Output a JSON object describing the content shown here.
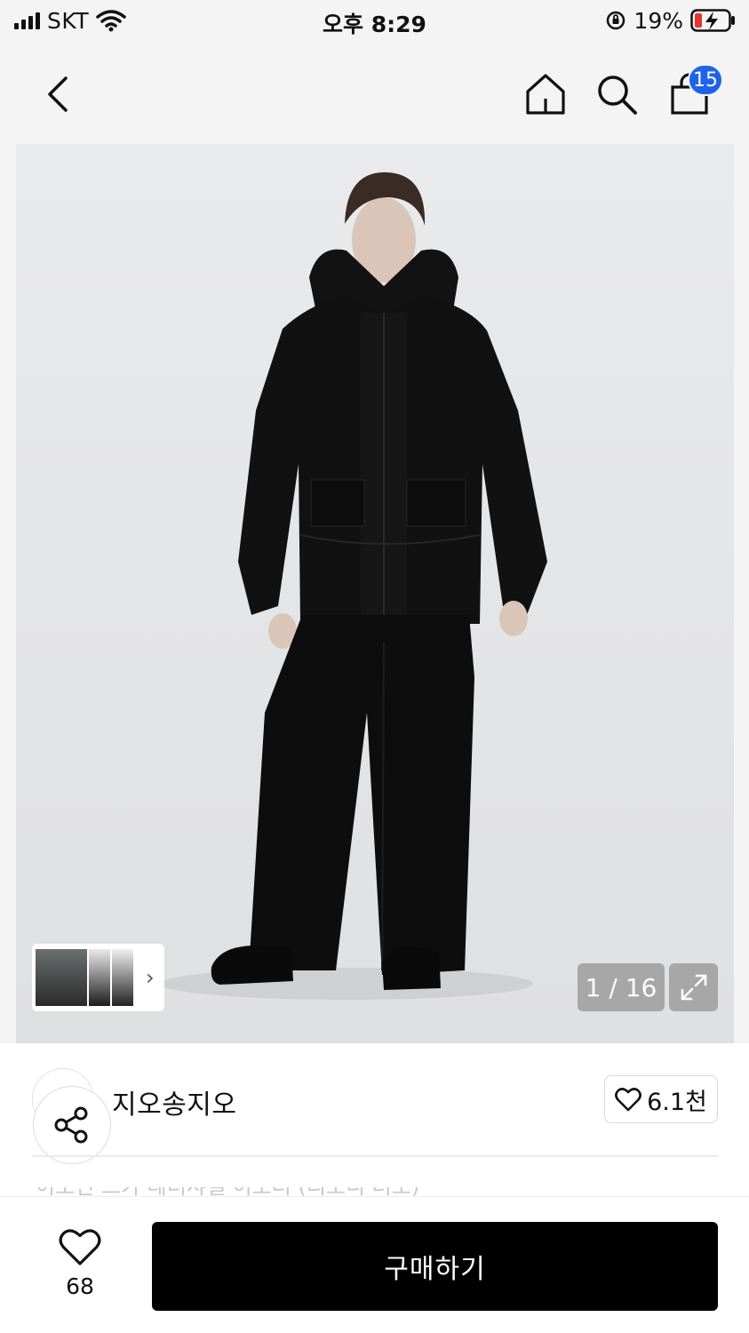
{
  "status_bar": {
    "carrier": "SKT",
    "time": "오후 8:29",
    "battery": "19%"
  },
  "nav": {
    "cart_badge": "15",
    "icons": [
      "chevron-left-icon",
      "home-icon",
      "search-icon",
      "shopping-bag-icon"
    ]
  },
  "gallery": {
    "counter": "1 / 16",
    "thumb_arrow": "›"
  },
  "product": {
    "brand": "지오송지오",
    "like_label": "6.1천",
    "faded_line": "이오던 스카 레더샤넬 이오더 (리오니 려오)"
  },
  "bottom": {
    "wish_count": "68",
    "buy_label": "구매하기"
  },
  "colors": {
    "badge": "#1e63e9",
    "buy_button": "#000000",
    "image_bg": "#e7e8ea"
  }
}
